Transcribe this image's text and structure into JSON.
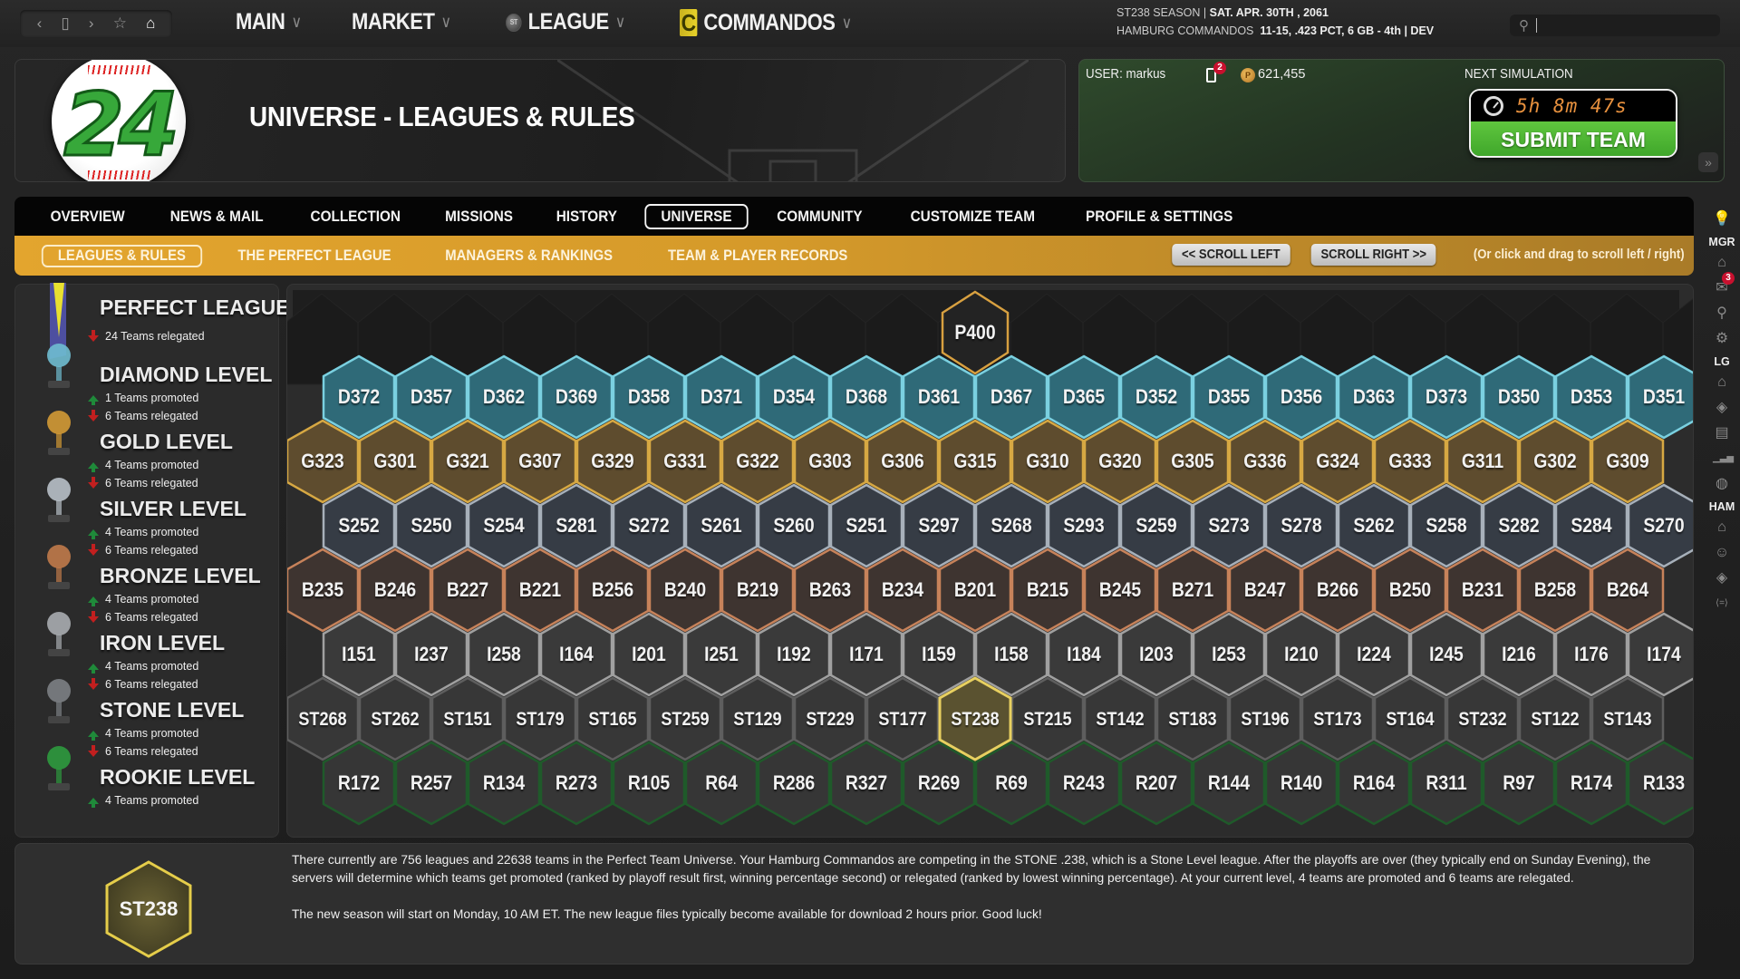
{
  "browser_controls": {
    "back": "‹",
    "tab": "▯",
    "forward": "›",
    "favorite": "☆",
    "home": "⌂"
  },
  "menus": [
    {
      "label": "MAIN",
      "icon": null
    },
    {
      "label": "MARKET",
      "icon": null
    },
    {
      "label": "LEAGUE",
      "icon": "league-logo-icon"
    },
    {
      "label": "COMMANDOS",
      "icon": "team-logo-icon"
    }
  ],
  "menu_chevron": "∨",
  "team_logo_letter": "C",
  "season_info": {
    "line1_a": "ST238 SEASON",
    "line1_sep": " | ",
    "line1_b": "SAT. APR. 30TH , 2061",
    "line2_a": "HAMBURG COMMANDOS",
    "line2_b": "11-15, .423 PCT, 6 GB - 4th | DEV"
  },
  "search": {
    "placeholder": "",
    "value": ""
  },
  "header": {
    "logo_number": "24",
    "title": "UNIVERSE - LEAGUES & RULES"
  },
  "account": {
    "user_label": "USER: markus",
    "device_badge": "2",
    "coins": "621,455",
    "next_sim_label": "NEXT SIMULATION",
    "timer": "5h 8m 47s",
    "submit_label": "SUBMIT TEAM",
    "collapse_icon": "»"
  },
  "main_nav": [
    {
      "label": "OVERVIEW",
      "active": false
    },
    {
      "label": "NEWS & MAIL",
      "active": false
    },
    {
      "label": "COLLECTION",
      "active": false
    },
    {
      "label": "MISSIONS",
      "active": false
    },
    {
      "label": "HISTORY",
      "active": false
    },
    {
      "label": "UNIVERSE",
      "active": true
    },
    {
      "label": "COMMUNITY",
      "active": false
    },
    {
      "label": "CUSTOMIZE TEAM",
      "active": false
    },
    {
      "label": "PROFILE & SETTINGS",
      "active": false
    }
  ],
  "sub_nav": [
    {
      "label": "LEAGUES & RULES",
      "active": true
    },
    {
      "label": "THE PERFECT LEAGUE",
      "active": false
    },
    {
      "label": "MANAGERS & RANKINGS",
      "active": false
    },
    {
      "label": "TEAM & PLAYER RECORDS",
      "active": false
    }
  ],
  "scroll": {
    "left_label": "<< SCROLL LEFT",
    "right_label": "SCROLL RIGHT >>",
    "hint": "(Or click and drag to scroll left / right)"
  },
  "rail": {
    "groups": [
      {
        "label": null,
        "icons": [
          {
            "name": "lightbulb-icon",
            "glyph": "💡"
          }
        ]
      },
      {
        "label": "MGR",
        "icons": [
          {
            "name": "home-icon",
            "glyph": "⌂"
          },
          {
            "name": "mail-icon",
            "glyph": "✉",
            "badge": "3"
          },
          {
            "name": "search-icon",
            "glyph": "⚲"
          },
          {
            "name": "gear-icon",
            "glyph": "⚙"
          }
        ]
      },
      {
        "label": "LG",
        "icons": [
          {
            "name": "home-icon",
            "glyph": "⌂"
          },
          {
            "name": "diamond-icon",
            "glyph": "◈"
          },
          {
            "name": "id-card-icon",
            "glyph": "▤"
          },
          {
            "name": "bar-chart-icon",
            "glyph": "▁▃▅"
          },
          {
            "name": "baseball-icon",
            "glyph": "◍"
          }
        ]
      },
      {
        "label": "HAM",
        "icons": [
          {
            "name": "home-icon",
            "glyph": "⌂"
          },
          {
            "name": "coach-icon",
            "glyph": "☺"
          },
          {
            "name": "diamond-icon",
            "glyph": "◈"
          },
          {
            "name": "code-icon",
            "glyph": "⟨=⟩"
          }
        ]
      }
    ]
  },
  "levels": [
    {
      "name": "PERFECT LEAGUE",
      "promoted": null,
      "relegated": "24 Teams relegated",
      "trophy": "perfect-trophy-icon",
      "color": "#e0d02a"
    },
    {
      "name": "DIAMOND LEVEL",
      "promoted": "1 Teams promoted",
      "relegated": "6 Teams relegated",
      "trophy": "diamond-trophy-icon",
      "color": "#6fbcd0"
    },
    {
      "name": "GOLD LEVEL",
      "promoted": "4 Teams promoted",
      "relegated": "6 Teams relegated",
      "trophy": "gold-trophy-icon",
      "color": "#d39a35"
    },
    {
      "name": "SILVER LEVEL",
      "promoted": "4 Teams promoted",
      "relegated": "6 Teams relegated",
      "trophy": "silver-trophy-icon",
      "color": "#b8c0c8"
    },
    {
      "name": "BRONZE LEVEL",
      "promoted": "4 Teams promoted",
      "relegated": "6 Teams relegated",
      "trophy": "bronze-trophy-icon",
      "color": "#c07a4a"
    },
    {
      "name": "IRON LEVEL",
      "promoted": "4 Teams promoted",
      "relegated": "6 Teams relegated",
      "trophy": "iron-trophy-icon",
      "color": "#a8acb0"
    },
    {
      "name": "STONE LEVEL",
      "promoted": "4 Teams promoted",
      "relegated": "6 Teams relegated",
      "trophy": "stone-trophy-icon",
      "color": "#7c8084"
    },
    {
      "name": "ROOKIE LEVEL",
      "promoted": "4 Teams promoted",
      "relegated": null,
      "trophy": "rookie-trophy-icon",
      "color": "#2e9a3e"
    }
  ],
  "grid": {
    "rows": [
      {
        "tier": "perfect",
        "fill": "#232323",
        "stroke": "#d8a040",
        "leagues": [
          "P400"
        ]
      },
      {
        "tier": "diamond",
        "fill": "#2f6a78",
        "stroke": "#7ad0e0",
        "leagues": [
          "D372",
          "D357",
          "D362",
          "D369",
          "D358",
          "D371",
          "D354",
          "D368",
          "D361",
          "D367",
          "D365",
          "D352",
          "D355",
          "D356",
          "D363",
          "D373",
          "D350",
          "D353",
          "D351"
        ]
      },
      {
        "tier": "gold",
        "fill": "#5e4c2e",
        "stroke": "#d7a843",
        "leagues": [
          "G323",
          "G301",
          "G321",
          "G307",
          "G329",
          "G331",
          "G322",
          "G303",
          "G306",
          "G315",
          "G310",
          "G320",
          "G305",
          "G336",
          "G324",
          "G333",
          "G311",
          "G302",
          "G309"
        ]
      },
      {
        "tier": "silver",
        "fill": "#363c45",
        "stroke": "#a7b0ba",
        "leagues": [
          "S252",
          "S250",
          "S254",
          "S281",
          "S272",
          "S261",
          "S260",
          "S251",
          "S297",
          "S268",
          "S293",
          "S259",
          "S273",
          "S278",
          "S262",
          "S258",
          "S282",
          "S284",
          "S270"
        ]
      },
      {
        "tier": "bronze",
        "fill": "#3e3430",
        "stroke": "#c7825a",
        "leagues": [
          "B235",
          "B246",
          "B227",
          "B221",
          "B256",
          "B240",
          "B219",
          "B263",
          "B234",
          "B201",
          "B215",
          "B245",
          "B271",
          "B247",
          "B266",
          "B250",
          "B231",
          "B258",
          "B264"
        ]
      },
      {
        "tier": "iron",
        "fill": "#3a3a3a",
        "stroke": "#a0a0a0",
        "leagues": [
          "I151",
          "I237",
          "I258",
          "I164",
          "I201",
          "I251",
          "I192",
          "I171",
          "I159",
          "I158",
          "I184",
          "I203",
          "I253",
          "I210",
          "I224",
          "I245",
          "I216",
          "I176",
          "I174"
        ]
      },
      {
        "tier": "stone",
        "fill": "#373737",
        "stroke": "#5e5e5e",
        "leagues": [
          "ST268",
          "ST262",
          "ST151",
          "ST179",
          "ST165",
          "ST259",
          "ST129",
          "ST229",
          "ST177",
          "ST238",
          "ST215",
          "ST142",
          "ST183",
          "ST196",
          "ST173",
          "ST164",
          "ST232",
          "ST122",
          "ST143"
        ]
      },
      {
        "tier": "rookie",
        "fill": "#363636",
        "stroke": "#1f5a2a",
        "leagues": [
          "R172",
          "R257",
          "R134",
          "R273",
          "R105",
          "R64",
          "R286",
          "R327",
          "R269",
          "R69",
          "R243",
          "R207",
          "R144",
          "R140",
          "R164",
          "R311",
          "R97",
          "R174",
          "R133"
        ]
      }
    ],
    "current_league": "ST238",
    "current_fill": "#5a5230",
    "current_stroke": "#e8d060"
  },
  "info": {
    "current_league": "ST238",
    "paragraph1": "There currently are 756 leagues and 22638 teams in the Perfect Team Universe. Your Hamburg Commandos are competing in the STONE .238, which is a Stone Level league. After the playoffs are over (they typically end on Sunday Evening), the servers will determine which teams get promoted (ranked by playoff result first, winning percentage second) or relegated (ranked by lowest winning percentage). At your current level, 4 teams are promoted and 6 teams are relegated.",
    "paragraph2": "The new season will start on Monday, 10 AM ET. The new league files typically become available for download 2 hours prior. Good luck!"
  }
}
